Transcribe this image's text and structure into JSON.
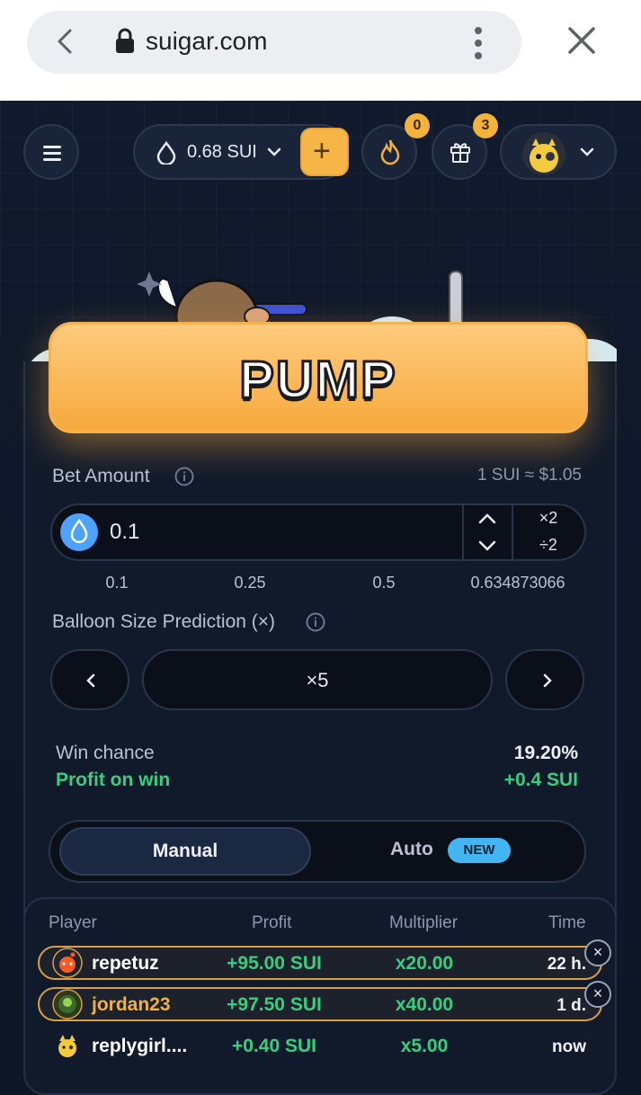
{
  "browser": {
    "url": "suigar.com",
    "icons": [
      "back-icon",
      "lock-icon",
      "more-vert-icon",
      "close-icon"
    ]
  },
  "topbar": {
    "balance": "0.68 SUI",
    "add_label": "+",
    "fire_count": "0",
    "gift_count": "3",
    "icons": [
      "menu-icon",
      "drop-icon",
      "chevron-down-icon",
      "fire-icon",
      "gift-icon"
    ]
  },
  "game": {
    "pump_label": "PUMP",
    "bet_label": "Bet Amount",
    "rate": "1 SUI ≈ $1.05",
    "bet_value": "0.1",
    "mul2": "×2",
    "div2": "÷2",
    "quick": [
      "0.1",
      "0.25",
      "0.5",
      "0.634873066"
    ],
    "size_label": "Balloon Size Prediction (×)",
    "size_value": "×5",
    "win_chance_label": "Win chance",
    "win_chance_value": "19.20%",
    "profit_label": "Profit on win",
    "profit_value": "+0.4 SUI",
    "mode_manual": "Manual",
    "mode_auto": "Auto",
    "new_badge": "NEW"
  },
  "board": {
    "headers": [
      "Player",
      "Profit",
      "Multiplier",
      "Time"
    ],
    "rows": [
      {
        "name": "repetuz",
        "profit": "+95.00 SUI",
        "mult": "x20.00",
        "time": "22 h.",
        "highlight": true
      },
      {
        "name": "jordan23",
        "profit": "+97.50 SUI",
        "mult": "x40.00",
        "time": "1 d.",
        "highlight": true
      },
      {
        "name": "replygirl....",
        "profit": "+0.40 SUI",
        "mult": "x5.00",
        "time": "now",
        "highlight": false
      }
    ],
    "dismiss": "×"
  },
  "colors": {
    "accent_orange": "#f7b548",
    "profit_green": "#35d07f",
    "new_blue": "#42b6f2",
    "highlight_gold": "#d9a043"
  }
}
